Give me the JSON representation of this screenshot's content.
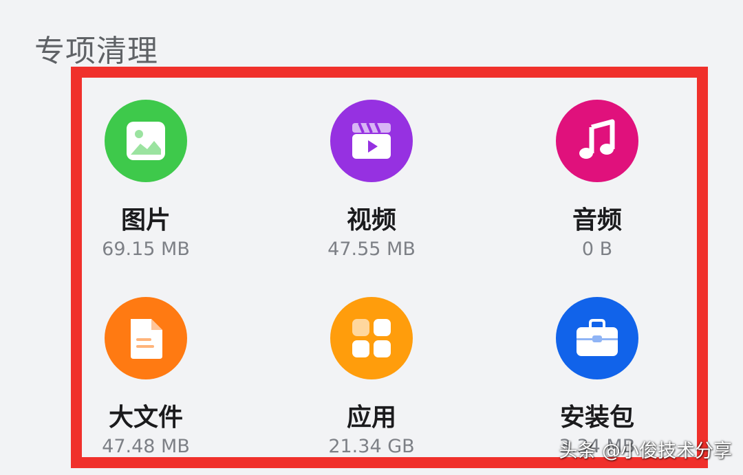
{
  "section": {
    "title": "专项清理"
  },
  "items": [
    {
      "label": "图片",
      "size": "69.15 MB",
      "icon": "image-icon",
      "color": "#3ec94b"
    },
    {
      "label": "视频",
      "size": "47.55 MB",
      "icon": "video-icon",
      "color": "#9631e1"
    },
    {
      "label": "音频",
      "size": "0 B",
      "icon": "music-note-icon",
      "color": "#e0117c"
    },
    {
      "label": "大文件",
      "size": "47.48 MB",
      "icon": "file-icon",
      "color": "#ff7a12"
    },
    {
      "label": "应用",
      "size": "21.34 GB",
      "icon": "apps-grid-icon",
      "color": "#ff9d0c"
    },
    {
      "label": "安装包",
      "size": "3.34 MB",
      "icon": "toolbox-icon",
      "color": "#1163ea"
    }
  ],
  "watermark": {
    "text": "头条 @小俊技术分享"
  },
  "colors": {
    "highlight": "#f0302b",
    "background": "#f2f3f5"
  }
}
